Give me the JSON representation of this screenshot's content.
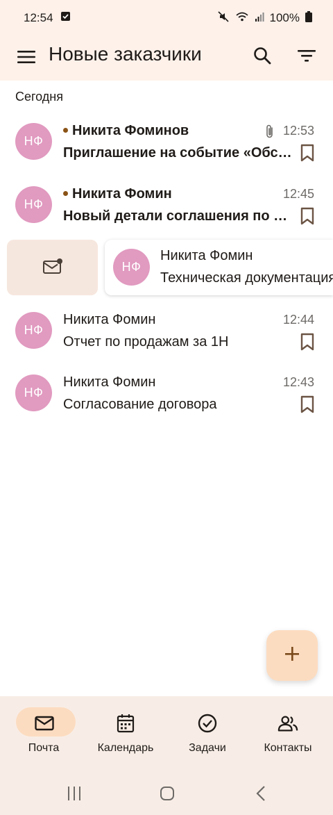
{
  "status_bar": {
    "time": "12:54",
    "battery": "100%"
  },
  "app_bar": {
    "title": "Новые заказчики"
  },
  "section": {
    "label": "Сегодня"
  },
  "messages": [
    {
      "initials": "НФ",
      "sender": "Никита Фоминов",
      "subject": "Приглашение на событие «Обсуждение",
      "time": "12:53",
      "unread": true,
      "attachment": true
    },
    {
      "initials": "НФ",
      "sender": "Никита Фомин",
      "subject": "Новый детали соглашения по проекту",
      "time": "12:45",
      "unread": true,
      "attachment": false
    },
    {
      "initials": "НФ",
      "sender": "Никита Фомин",
      "subject": "Техническая документация",
      "time": "",
      "unread": false,
      "swiped": true
    },
    {
      "initials": "НФ",
      "sender": "Никита Фомин",
      "subject": "Отчет по продажам за 1Н",
      "time": "12:44",
      "unread": false,
      "attachment": false
    },
    {
      "initials": "НФ",
      "sender": "Никита Фомин",
      "subject": "Согласование договора",
      "time": "12:43",
      "unread": false,
      "attachment": false
    }
  ],
  "fab": {
    "icon": "plus-icon"
  },
  "bottom_nav": {
    "items": [
      {
        "label": "Почта",
        "icon": "mail-icon",
        "active": true
      },
      {
        "label": "Календарь",
        "icon": "calendar-icon",
        "active": false
      },
      {
        "label": "Задачи",
        "icon": "check-circle-icon",
        "active": false
      },
      {
        "label": "Контакты",
        "icon": "contacts-icon",
        "active": false
      }
    ]
  },
  "colors": {
    "header_bg": "#fdf1ea",
    "avatar_bg": "#e19ac0",
    "accent": "#fcdcc0",
    "unread_dot": "#8a5316",
    "icon_brown": "#6b5444"
  }
}
